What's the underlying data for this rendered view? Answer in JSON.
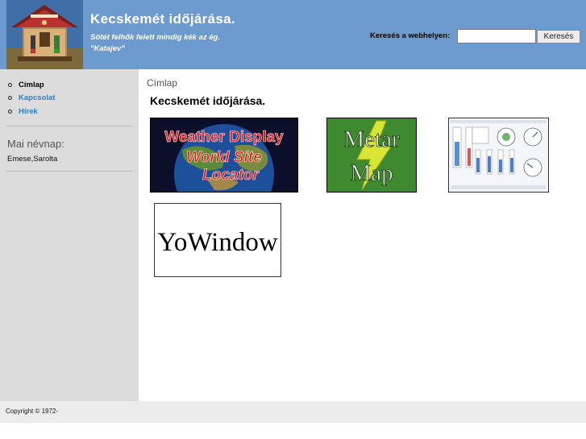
{
  "header": {
    "title": "Kecskemét időjárása.",
    "slogan_line1": "Sötét felhők felett mindig kék az ég.",
    "slogan_line2": "\"Katajev\"",
    "search_label": "Keresés a webhelyen:",
    "search_value": "",
    "search_button": "Keresés"
  },
  "sidebar": {
    "items": [
      {
        "label": "Címlap",
        "color": "#000000"
      },
      {
        "label": "Kapcsolat",
        "color": "#2a7fd4"
      },
      {
        "label": "Hírek",
        "color": "#2a7fd4"
      }
    ],
    "nameday_title": "Mai névnap:",
    "nameday_value": "Emese,Sarolta"
  },
  "main": {
    "breadcrumb": "Címlap",
    "title": "Kecskemét időjárása.",
    "banners": [
      {
        "name": "weather-display-banner",
        "line1": "Weather Display",
        "line2": "World Site",
        "line3": "Locator"
      },
      {
        "name": "metar-map-banner",
        "line1": "Metar",
        "line2": "Map"
      },
      {
        "name": "weather-dashboard-thumbnail"
      },
      {
        "name": "yowindow-banner",
        "text": "YoWindow"
      }
    ]
  },
  "footer": {
    "copyright": "Copyright © 1972-"
  },
  "colors": {
    "header_bg": "#6e9bcf",
    "sidebar_bg": "#dcdcdc",
    "link": "#2a7fd4",
    "footer_bg": "#ececec"
  }
}
